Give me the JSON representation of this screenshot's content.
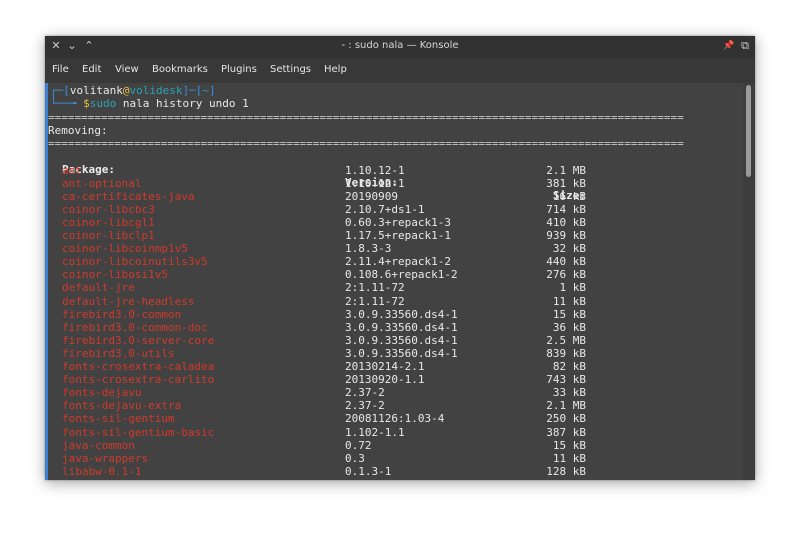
{
  "window": {
    "title": "- : sudo nala — Konsole",
    "controls": {
      "close": "✕",
      "minimize": "⌄",
      "maximize": "⌃",
      "pin": "📌",
      "restore": "⧉"
    }
  },
  "menu": [
    "File",
    "Edit",
    "View",
    "Bookmarks",
    "Plugins",
    "Settings",
    "Help"
  ],
  "prompt": {
    "corner_top": "┌─",
    "open": "[",
    "user": "volitank",
    "at": "@",
    "host": "volidesk",
    "sep": "]─[",
    "cwd": "~",
    "close": "]",
    "corner_bottom": "└──╼ ",
    "dollar": "$",
    "sudo": "sudo",
    "command": " nala history undo 1"
  },
  "rule": "================================================================================================",
  "section_label": "Removing:",
  "table": {
    "headers": {
      "package": "Package:",
      "version": "Version:",
      "size": "Size:"
    },
    "rows": [
      {
        "package": "ant",
        "version": "1.10.12-1",
        "size": "2.1 MB"
      },
      {
        "package": "ant-optional",
        "version": "1.10.12-1",
        "size": "381 kB"
      },
      {
        "package": "ca-certificates-java",
        "version": "20190909",
        "size": "16 kB"
      },
      {
        "package": "coinor-libcbc3",
        "version": "2.10.7+ds1-1",
        "size": "714 kB"
      },
      {
        "package": "coinor-libcgl1",
        "version": "0.60.3+repack1-3",
        "size": "410 kB"
      },
      {
        "package": "coinor-libclp1",
        "version": "1.17.5+repack1-1",
        "size": "939 kB"
      },
      {
        "package": "coinor-libcoinmp1v5",
        "version": "1.8.3-3",
        "size": "32 kB"
      },
      {
        "package": "coinor-libcoinutils3v5",
        "version": "2.11.4+repack1-2",
        "size": "440 kB"
      },
      {
        "package": "coinor-libosi1v5",
        "version": "0.108.6+repack1-2",
        "size": "276 kB"
      },
      {
        "package": "default-jre",
        "version": "2:1.11-72",
        "size": "1 kB"
      },
      {
        "package": "default-jre-headless",
        "version": "2:1.11-72",
        "size": "11 kB"
      },
      {
        "package": "firebird3.0-common",
        "version": "3.0.9.33560.ds4-1",
        "size": "15 kB"
      },
      {
        "package": "firebird3.0-common-doc",
        "version": "3.0.9.33560.ds4-1",
        "size": "36 kB"
      },
      {
        "package": "firebird3.0-server-core",
        "version": "3.0.9.33560.ds4-1",
        "size": "2.5 MB"
      },
      {
        "package": "firebird3.0-utils",
        "version": "3.0.9.33560.ds4-1",
        "size": "839 kB"
      },
      {
        "package": "fonts-crosextra-caladea",
        "version": "20130214-2.1",
        "size": "82 kB"
      },
      {
        "package": "fonts-crosextra-carlito",
        "version": "20130920-1.1",
        "size": "743 kB"
      },
      {
        "package": "fonts-dejavu",
        "version": "2.37-2",
        "size": "33 kB"
      },
      {
        "package": "fonts-dejavu-extra",
        "version": "2.37-2",
        "size": "2.1 MB"
      },
      {
        "package": "fonts-sil-gentium",
        "version": "20081126:1.03-4",
        "size": "250 kB"
      },
      {
        "package": "fonts-sil-gentium-basic",
        "version": "1.102-1.1",
        "size": "387 kB"
      },
      {
        "package": "java-common",
        "version": "0.72",
        "size": "15 kB"
      },
      {
        "package": "java-wrappers",
        "version": "0.3",
        "size": "11 kB"
      },
      {
        "package": "libabw-0.1-1",
        "version": "0.1.3-1",
        "size": "128 kB"
      }
    ]
  },
  "colors": {
    "window_bg": "#424242",
    "titlebar_bg": "#323232",
    "prompt_blue": "#3a8fe0",
    "prompt_yellow": "#e7c13d",
    "prompt_cyan": "#2aa3b3",
    "package_red": "#d03a2c",
    "focus_accent": "#3d7fd1"
  }
}
